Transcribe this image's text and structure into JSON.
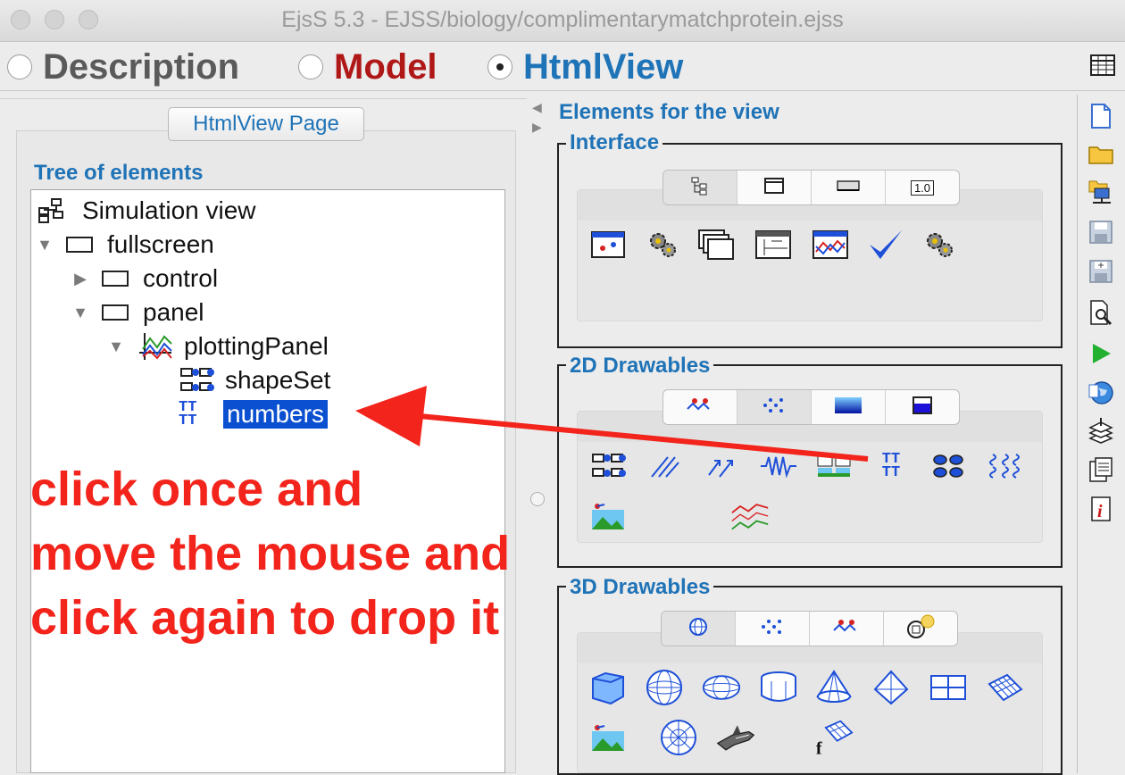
{
  "window": {
    "title": "EjsS 5.3 - EJSS/biology/complimentarymatchprotein.ejss"
  },
  "modes": [
    {
      "label": "Description",
      "selected": false,
      "color": "#5a5a5a"
    },
    {
      "label": "Model",
      "selected": false,
      "color": "#b01818"
    },
    {
      "label": "HtmlView",
      "selected": true,
      "color": "#1f73b7"
    }
  ],
  "left_panel": {
    "page_tab": "HtmlView Page",
    "tree_heading": "Tree of elements",
    "tree": [
      {
        "label": "Simulation view",
        "icon": "simulation-view-icon",
        "expander": ""
      },
      {
        "label": "fullscreen",
        "icon": "panel-icon",
        "expander": "expanded"
      },
      {
        "label": "control",
        "icon": "panel-icon",
        "expander": "collapsed"
      },
      {
        "label": "panel",
        "icon": "panel-icon",
        "expander": "expanded"
      },
      {
        "label": "plottingPanel",
        "icon": "plotting-panel-icon",
        "expander": "expanded"
      },
      {
        "label": "shapeSet",
        "icon": "shape-set-icon",
        "expander": ""
      },
      {
        "label": "numbers",
        "icon": "text-set-icon",
        "expander": "",
        "selected": true
      }
    ]
  },
  "annotation": {
    "lines": [
      "click once and",
      "move the mouse and",
      "click again to drop it"
    ],
    "color": "#f2241b"
  },
  "right_panel": {
    "heading": "Elements for the view",
    "groups": [
      {
        "title": "Interface",
        "tabs": [
          "tree-icon",
          "window-icon",
          "button-icon",
          "number-field-icon"
        ],
        "tab_number_label": "1.0",
        "icons": [
          "plotting-panel-icon",
          "gear-icon",
          "multi-window-icon",
          "chart-panel-icon",
          "trace-panel-icon",
          "checkmark-icon",
          "gear-icon"
        ]
      },
      {
        "title": "2D Drawables",
        "tabs": [
          "trail-icon",
          "particles-icon",
          "gradient-icon",
          "tank-icon"
        ],
        "icons": [
          "shape-set-icon",
          "segments-icon",
          "arrows-icon",
          "spring-icon",
          "images-icon",
          "text-set-icon",
          "ellipses-icon",
          "springs-set-icon",
          "image-icon",
          "traces-icon"
        ]
      },
      {
        "title": "3D Drawables",
        "tabs": [
          "sphere-icon",
          "particles-icon",
          "trail-icon",
          "rotation-icon"
        ],
        "icons": [
          "box-icon",
          "sphere-icon",
          "ellipsoid-icon",
          "cylinder-icon",
          "cone-icon",
          "diamond-icon",
          "plane-icon",
          "surface-icon",
          "image-icon",
          "disk-icon",
          "shuttle-icon",
          "function-surface-icon"
        ]
      }
    ]
  },
  "toolbar": [
    "new-file-icon",
    "open-folder-icon",
    "open-network-icon",
    "save-icon",
    "save-as-icon",
    "search-icon",
    "run-icon",
    "web-icon",
    "layers-icon",
    "clipboard-icon",
    "info-icon"
  ]
}
